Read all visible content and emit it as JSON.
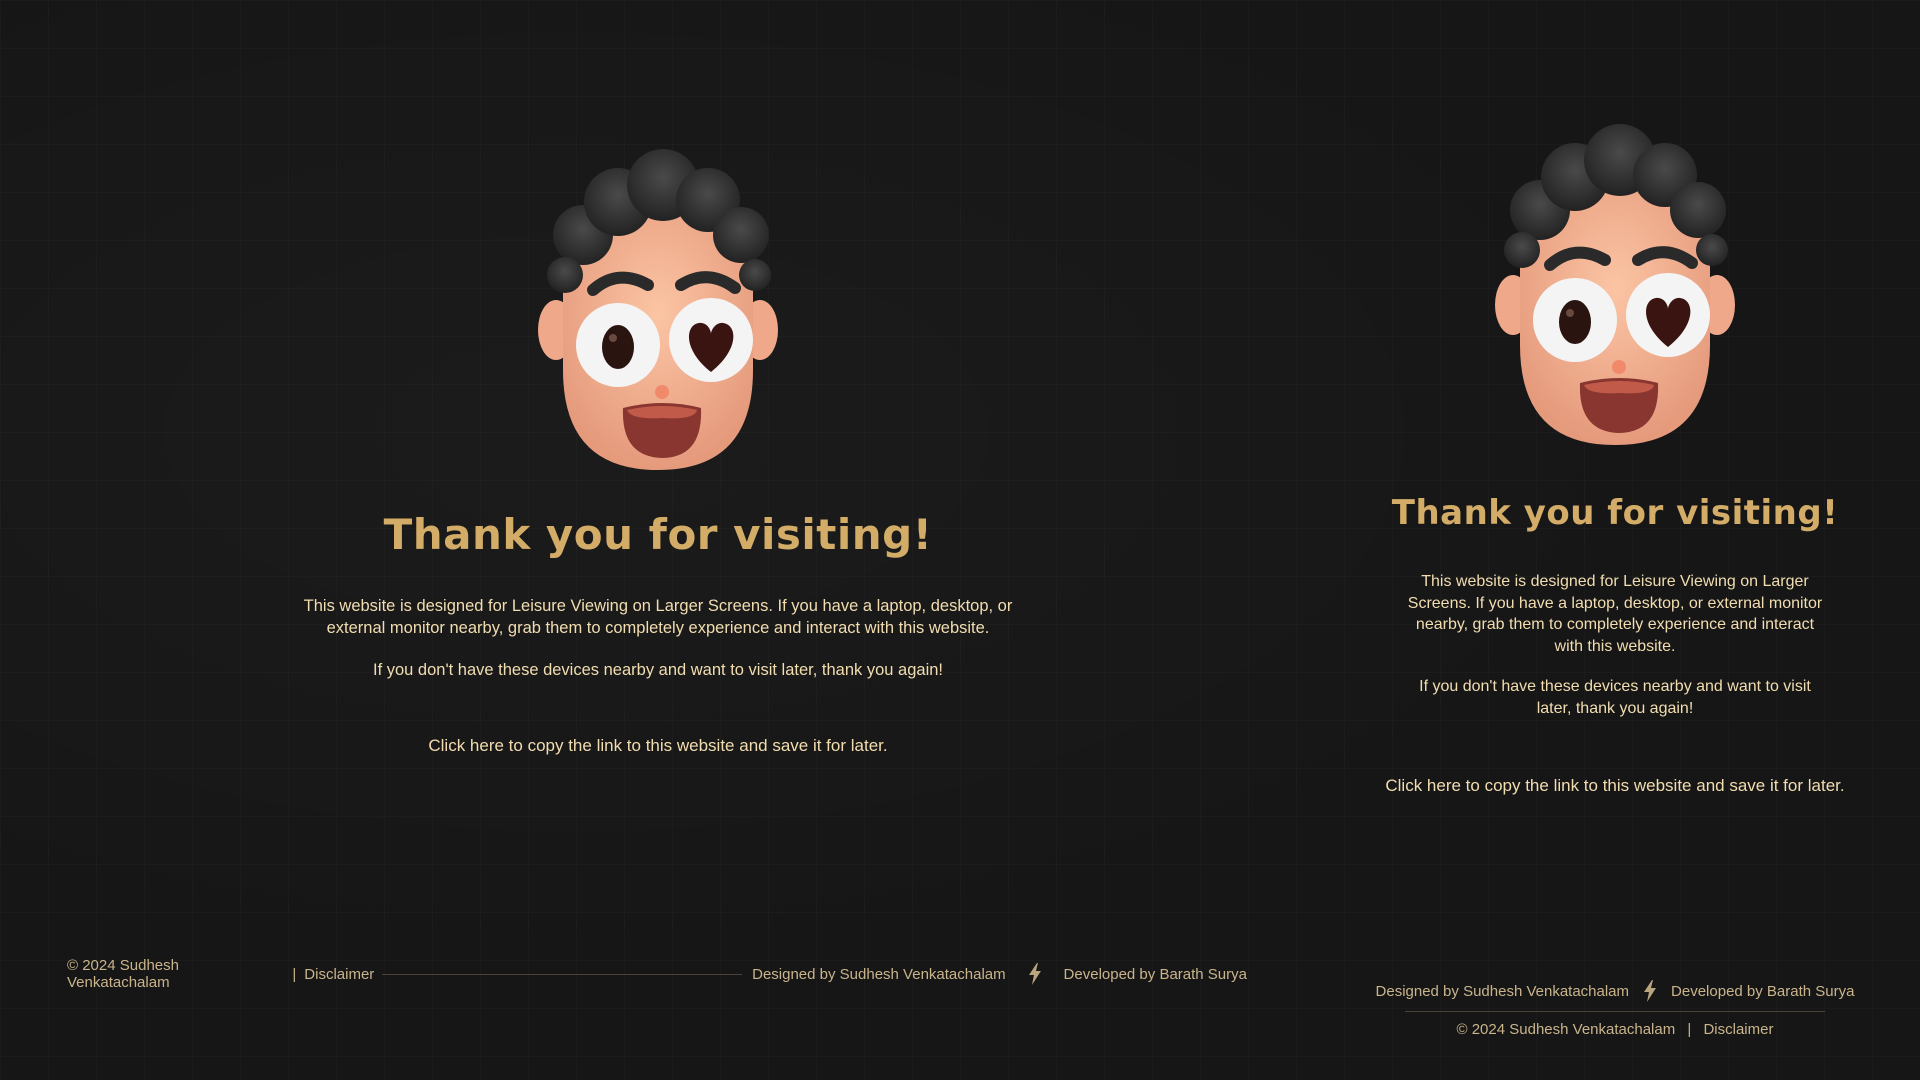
{
  "main": {
    "title": "Thank you for visiting!",
    "paragraph1": "This website is designed for Leisure Viewing on Larger Screens. If you have a laptop, desktop, or external monitor nearby, grab them to completely experience and interact with this website.",
    "paragraph2": "If you don't have these devices nearby and want to visit later, thank you again!",
    "copy_link": "Click here to copy the link to this website and save it for later."
  },
  "footer": {
    "copyright": "© 2024 Sudhesh Venkatachalam",
    "separator": "|",
    "disclaimer": "Disclaimer",
    "designed_by": "Designed by Sudhesh Venkatachalam",
    "developed_by": "Developed by Barath Surya"
  },
  "icons": {
    "avatar": "heart-eyes-avatar-icon",
    "credit_separator": "lightning-bolt-icon"
  },
  "colors": {
    "background": "#161616",
    "title": "#d3ac68",
    "text": "#f2ddb0",
    "footer_text": "#c9b48c"
  }
}
